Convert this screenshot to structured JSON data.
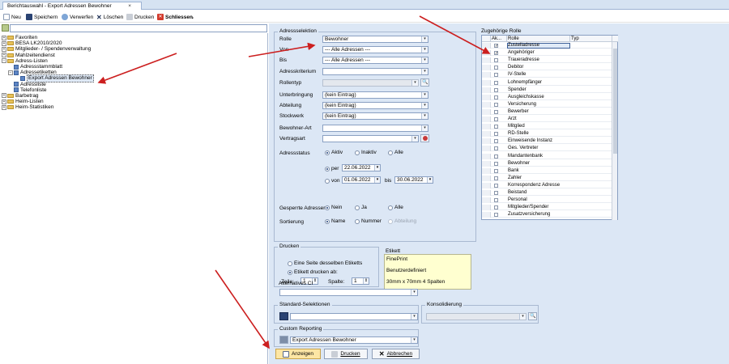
{
  "tab": {
    "title": "Berichtauswahl - Export Adressen Bewohner",
    "close": "×"
  },
  "toolbar": {
    "neu": "Neu",
    "speichern": "Speichern",
    "verwerfen": "Verwerfen",
    "loeschen": "Löschen",
    "drucken": "Drucken",
    "schliessen": "Schliessen",
    "more": "⌄"
  },
  "tree": [
    {
      "label": "Favoriten",
      "level": 0,
      "type": "folder",
      "exp": "+"
    },
    {
      "label": "BESA LK2010/2020",
      "level": 0,
      "type": "folder",
      "exp": "+"
    },
    {
      "label": "Mitglieder- / Spendenverwaltung",
      "level": 0,
      "type": "folder",
      "exp": "+"
    },
    {
      "label": "Mahlzeitendienst",
      "level": 0,
      "type": "folder",
      "exp": "+"
    },
    {
      "label": "Adress-Listen",
      "level": 0,
      "type": "folder",
      "exp": "−"
    },
    {
      "label": "Adressstammblatt",
      "level": 1,
      "type": "doc",
      "exp": ""
    },
    {
      "label": "Adressetiketten",
      "level": 1,
      "type": "doc",
      "exp": "−"
    },
    {
      "label": "Export Adressen Bewohner",
      "level": 2,
      "type": "doc",
      "exp": "",
      "selected": true
    },
    {
      "label": "Adressliste",
      "level": 1,
      "type": "doc",
      "exp": ""
    },
    {
      "label": "Telefonliste",
      "level": 1,
      "type": "doc",
      "exp": ""
    },
    {
      "label": "Barbetrag",
      "level": 0,
      "type": "folder",
      "exp": "+"
    },
    {
      "label": "Heim-Listen",
      "level": 0,
      "type": "folder",
      "exp": "+"
    },
    {
      "label": "Heim-Statistiken",
      "level": 0,
      "type": "folder",
      "exp": "+"
    }
  ],
  "adressselektion": {
    "title": "Adressselektion",
    "rolle_label": "Rolle",
    "rolle_value": "Bewohner",
    "von_label": "Von",
    "von_value": "--- Alle Adressen ---",
    "bis_label": "Bis",
    "bis_value": "--- Alle Adressen ---",
    "kriterium_label": "Adresskriterium",
    "rollentyp_label": "Rollentyp",
    "unterbringung_label": "Unterbringung",
    "unterbringung_value": "(kein Eintrag)",
    "abteilung_label": "Abteilung",
    "abteilung_value": "(kein Eintrag)",
    "stockwerk_label": "Stockwerk",
    "stockwerk_value": "(kein Eintrag)",
    "bewohnerart_label": "Bewohner-Art",
    "vertragsart_label": "Vertragsart",
    "adressstatus_label": "Adressstatus",
    "aktiv": "Aktiv",
    "inaktiv": "Inaktiv",
    "alle": "Alle",
    "per": "per",
    "per_date": "22.06.2022",
    "von": "von",
    "von_date": "01.06.2022",
    "bis": "bis",
    "bis_date": "30.06.2022",
    "gesperrt_label": "Gesperrte Adressen:",
    "nein": "Nein",
    "ja": "Ja",
    "alle2": "Alle",
    "sortierung_label": "Sortierung",
    "name": "Name",
    "nummer": "Nummer",
    "abteilung_sort": "Abteilung"
  },
  "rollen": {
    "title": "Zugehörige Rolle",
    "col_ak": "Ak...",
    "col_rolle": "Rolle",
    "col_typ": "Typ",
    "items": [
      {
        "name": "Zustelladresse",
        "checked": true,
        "selected": true
      },
      {
        "name": "Angehöriger",
        "checked": true
      },
      {
        "name": "Traueradresse"
      },
      {
        "name": "Debitor"
      },
      {
        "name": "IV-Stelle"
      },
      {
        "name": "Lohnempfänger"
      },
      {
        "name": "Spender"
      },
      {
        "name": "Ausgleichskasse"
      },
      {
        "name": "Versicherung"
      },
      {
        "name": "Bewerber"
      },
      {
        "name": "Arzt"
      },
      {
        "name": "Mitglied"
      },
      {
        "name": "RD-Stelle"
      },
      {
        "name": "Einweisende Instanz"
      },
      {
        "name": "Ges. Vertreter"
      },
      {
        "name": "Mandantenbank"
      },
      {
        "name": "Bewohner"
      },
      {
        "name": "Bank"
      },
      {
        "name": "Zahler"
      },
      {
        "name": "Korrespondenz Adresse"
      },
      {
        "name": "Beistand"
      },
      {
        "name": "Personal"
      },
      {
        "name": "Mitglieder/Spender"
      },
      {
        "name": "Zusatzversicherung"
      }
    ]
  },
  "drucken": {
    "title": "Drucken",
    "seite": "Eine Seite desselben Etiketts",
    "etikett_ab": "Etikett drucken ab:",
    "zeile": "Zeile:",
    "zeile_value": "1",
    "spalte": "Spalte:",
    "spalte_value": "1"
  },
  "etikett": {
    "title": "Etikett",
    "line1": "FinePrint",
    "line2": "Benutzerdefiniert",
    "line3": "30mm x 70mm  4 Spalten"
  },
  "alternatives_ci": {
    "title": "Alternatives CI"
  },
  "standard_selektionen": {
    "title": "Standard-Selektionen"
  },
  "konsolidierung": {
    "title": "Konsolidierung"
  },
  "custom_reporting": {
    "title": "Custom Reporting",
    "value": "Export Adressen Bewohner"
  },
  "buttons": {
    "anzeigen": "Anzeigen",
    "drucken": "Drucken",
    "abbrechen": "Abbrechen"
  },
  "colors": {
    "accent": "#dce7f5",
    "arrow": "#cc1f1f",
    "highlight_button": "#fde6a4"
  }
}
